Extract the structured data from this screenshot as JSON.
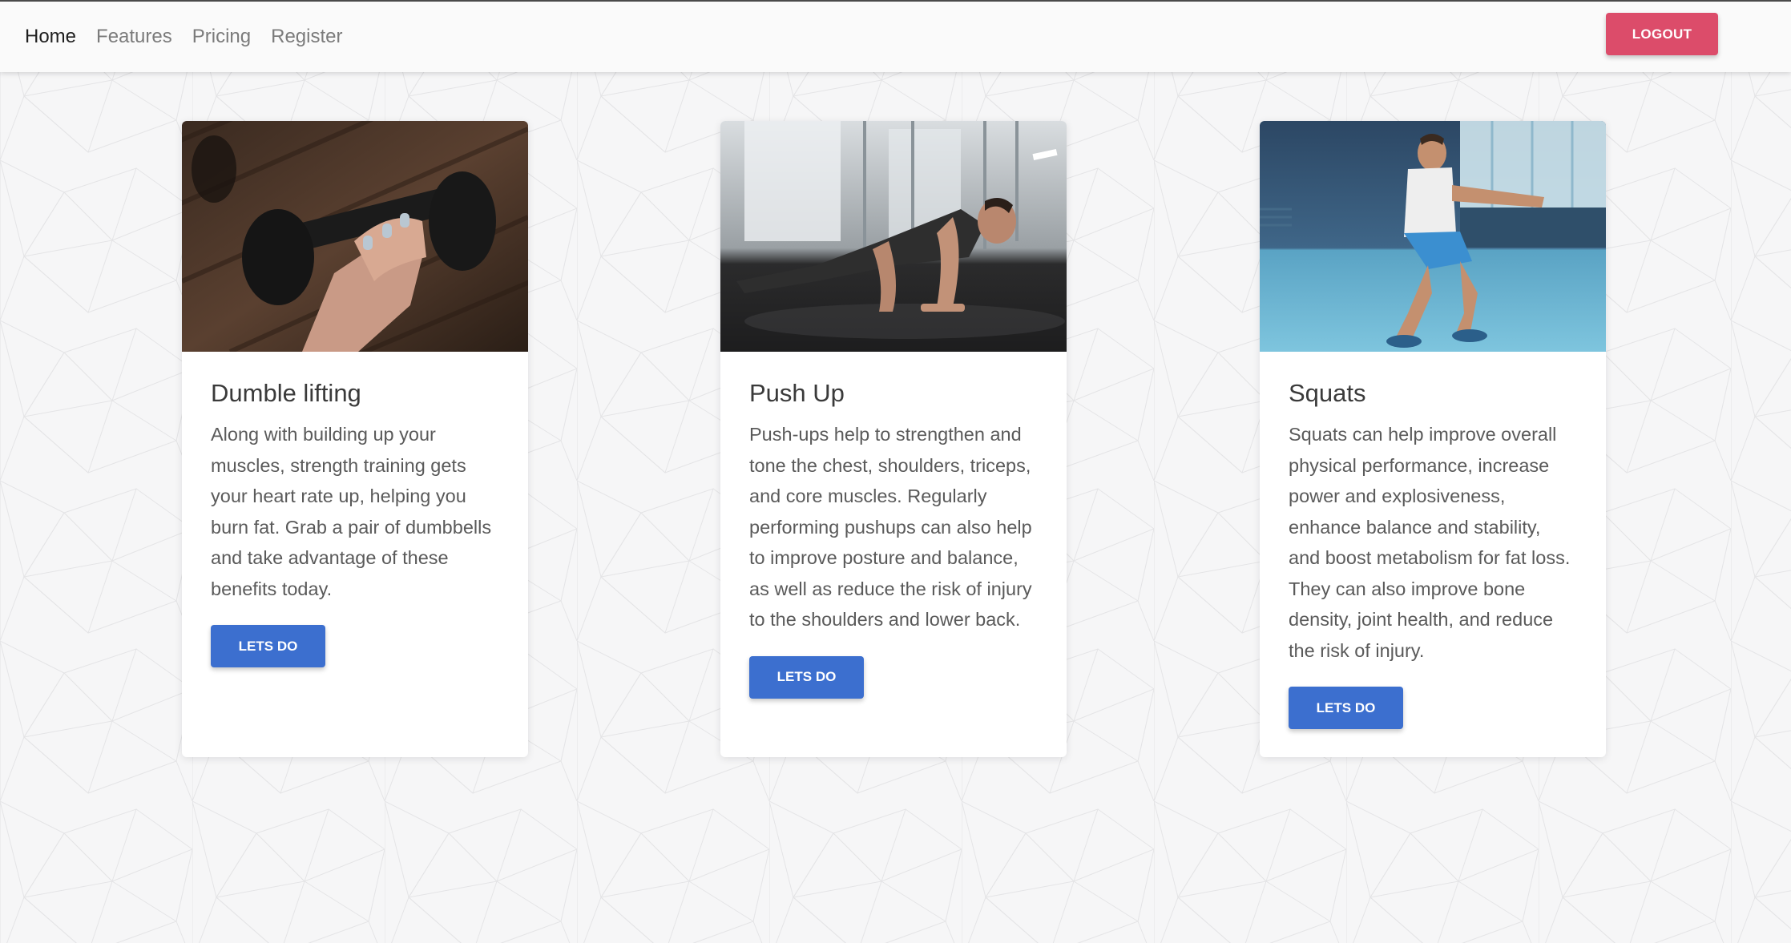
{
  "nav": {
    "items": [
      "Home",
      "Features",
      "Pricing",
      "Register"
    ],
    "logout_label": "LOGOUT"
  },
  "cards": [
    {
      "image": "dumbbell-lifting-photo",
      "title": "Dumble lifting",
      "text": "Along with building up your muscles, strength training gets your heart rate up, helping you burn fat. Grab a pair of dumbbells and take advantage of these benefits today.",
      "button_label": "LETS DO"
    },
    {
      "image": "push-up-photo",
      "title": "Push Up",
      "text": "Push-ups help to strengthen and tone the chest, shoulders, triceps, and core muscles. Regularly performing pushups can also help to improve posture and balance, as well as reduce the risk of injury to the shoulders and lower back.",
      "button_label": "LETS DO"
    },
    {
      "image": "squats-photo",
      "title": "Squats",
      "text": "Squats can help improve overall physical performance, increase power and explosiveness, enhance balance and stability, and boost metabolism for fat loss. They can also improve bone density, joint health, and reduce the risk of injury.",
      "button_label": "LETS DO"
    }
  ],
  "colors": {
    "navbar_bg": "#fafafa",
    "logout_button": "#dc4c6a",
    "action_button": "#3c6fcf",
    "page_bg": "#f6f6f7"
  }
}
